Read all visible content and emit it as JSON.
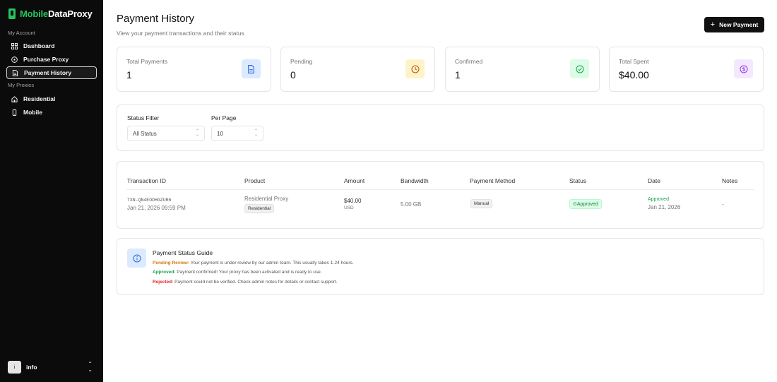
{
  "brand": {
    "name_prefix": "Mobile",
    "name_suffix": "DataProxy"
  },
  "sidebar": {
    "section_account": "My Account",
    "section_proxies": "My Proxies",
    "items": [
      {
        "label": "Dashboard",
        "icon": "grid-icon"
      },
      {
        "label": "Purchase Proxy",
        "icon": "circle-plus-icon"
      },
      {
        "label": "Payment History",
        "icon": "document-icon",
        "active": true
      },
      {
        "label": "Residential",
        "icon": "home-icon"
      },
      {
        "label": "Mobile",
        "icon": "phone-icon"
      }
    ],
    "user": {
      "avatar": "i",
      "name": "info"
    }
  },
  "header": {
    "title": "Payment History",
    "subtitle": "View your payment transactions and their status",
    "new_payment_label": "New Payment"
  },
  "stats": [
    {
      "label": "Total Payments",
      "value": "1",
      "icon": "document-icon",
      "color": "#dbeafe",
      "icon_color": "#2563eb"
    },
    {
      "label": "Pending",
      "value": "0",
      "icon": "clock-icon",
      "color": "#fef3c7",
      "icon_color": "#b45309"
    },
    {
      "label": "Confirmed",
      "value": "1",
      "icon": "check-circle-icon",
      "color": "#dcfce7",
      "icon_color": "#16a34a"
    },
    {
      "label": "Total Spent",
      "value": "$40.00",
      "icon": "dollar-icon",
      "color": "#f3e8ff",
      "icon_color": "#9333ea"
    }
  ],
  "filters": {
    "status_label": "Status Filter",
    "status_value": "All Status",
    "per_page_label": "Per Page",
    "per_page_value": "10"
  },
  "table": {
    "headers": [
      "Transaction ID",
      "Product",
      "Amount",
      "Bandwidth",
      "Payment Method",
      "Status",
      "Date",
      "Notes"
    ],
    "rows": [
      {
        "txn_id": "TXN-QN4EODHGZUR6",
        "txn_date": "Jan 21, 2026 09:59 PM",
        "product": "Residential Proxy",
        "product_tag": "Residential",
        "amount": "$40.00",
        "currency": "USD",
        "bandwidth": "5.00 GB",
        "method": "Manual",
        "status": "Approved",
        "date_status": "Approved",
        "date": "Jan 21, 2026",
        "notes": "-"
      }
    ]
  },
  "guide": {
    "title": "Payment Status Guide",
    "pending_label": "Pending Review:",
    "pending_text": " Your payment is under review by our admin team. This usually takes 1-24 hours.",
    "approved_label": "Approved:",
    "approved_text": " Payment confirmed! Your proxy has been activated and is ready to use.",
    "rejected_label": "Rejected:",
    "rejected_text": " Payment could not be verified. Check admin notes for details or contact support."
  },
  "colors": {
    "brand_green": "#22c55e",
    "sidebar_bg": "#0b0b0b",
    "pending": "#d97706",
    "approved": "#16a34a",
    "rejected": "#dc2626"
  }
}
